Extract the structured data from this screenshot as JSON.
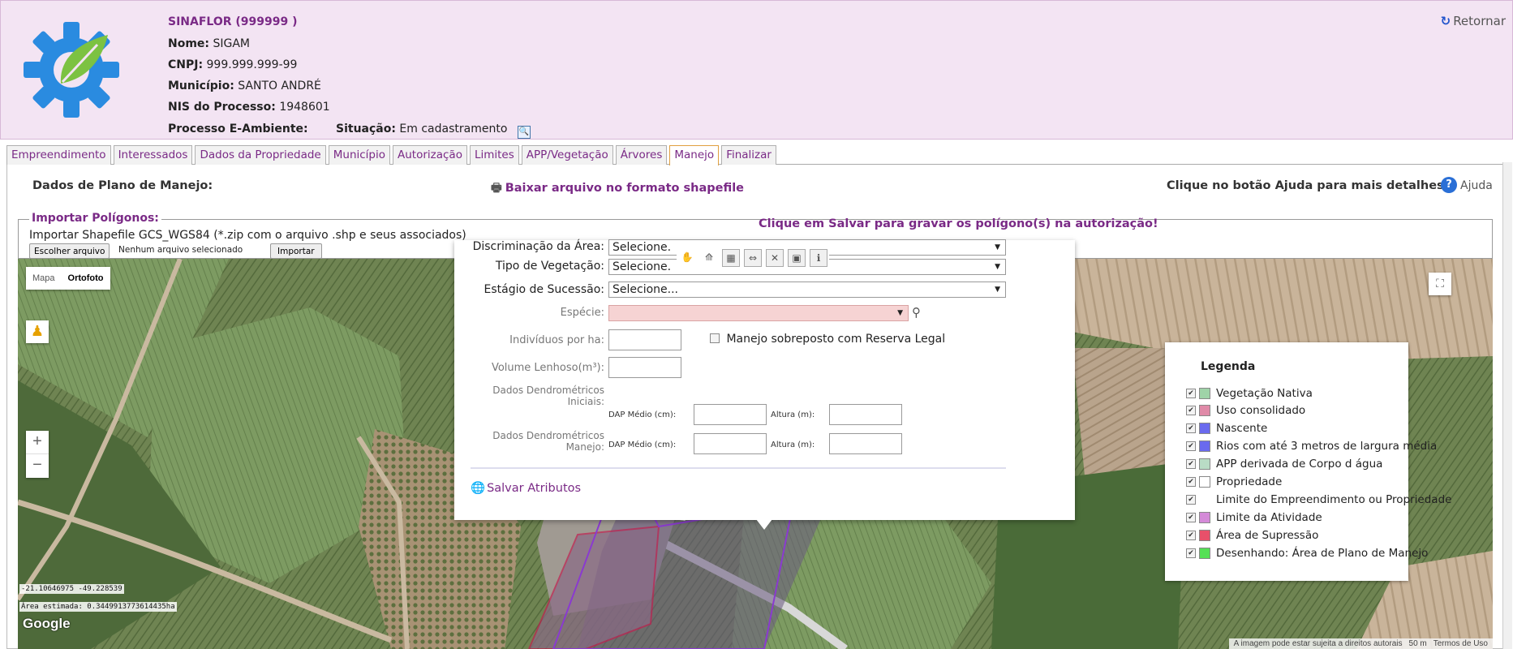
{
  "header": {
    "system": "SINAFLOR (999999 )",
    "nome_label": "Nome:",
    "nome_value": "SIGAM",
    "cnpj_label": "CNPJ:",
    "cnpj_value": "999.999.999-99",
    "municipio_label": "Município:",
    "municipio_value": "SANTO ANDRÉ",
    "nis_label": "NIS do Processo:",
    "nis_value": "1948601",
    "processo_label": "Processo E-Ambiente:",
    "situacao_label": "Situação:",
    "situacao_value": "Em cadastramento",
    "retornar": "Retornar",
    "brand_color": "#7a2a86"
  },
  "tabs": [
    {
      "label": "Empreendimento"
    },
    {
      "label": "Interessados"
    },
    {
      "label": "Dados da Propriedade"
    },
    {
      "label": "Município"
    },
    {
      "label": "Autorização"
    },
    {
      "label": "Limites"
    },
    {
      "label": "APP/Vegetação"
    },
    {
      "label": "Árvores"
    },
    {
      "label": "Manejo",
      "active": true
    },
    {
      "label": "Finalizar"
    }
  ],
  "main": {
    "dados_label": "Dados de Plano de Manejo:",
    "baixar": "Baixar arquivo no formato shapefile",
    "ajuda_hint": "Clique no botão Ajuda para mais detalhes.",
    "ajuda": "Ajuda"
  },
  "import": {
    "legend": "Importar Polígonos:",
    "desc": "Importar Shapefile GCS_WGS84 (*.zip com o arquivo .shp e seus associados)",
    "choose_btn": "Escolher arquivo",
    "no_file": "Nenhum arquivo selecionado",
    "import_btn": "Importar",
    "save_msg": "Clique em Salvar para gravar os polígono(s) na autorização!"
  },
  "map": {
    "type_mapa": "Mapa",
    "type_ortofoto": "Ortofoto",
    "zoom_in": "+",
    "zoom_out": "−",
    "coords": "-21.10646975 -49.228539",
    "area": "Área estimada: 0.3449913773614435ha",
    "google": "Google",
    "attrib": "A imagem pode estar sujeita a direitos autorais",
    "scale": "50 m",
    "terms": "Termos de Uso"
  },
  "popup": {
    "discriminacao_label": "Discriminação da Área:",
    "discriminacao_value": "Selecione.",
    "tipo_label": "Tipo de Vegetação:",
    "tipo_value": "Selecione.",
    "estagio_label": "Estágio de Sucessão:",
    "estagio_value": "Selecione...",
    "especie_label": "Espécie:",
    "individuos_label": "Indivíduos por ha:",
    "manejo_sobreposto": "Manejo sobreposto com Reserva Legal",
    "volume_label": "Volume Lenhoso(m³):",
    "dendro_iniciais_label": "Dados Dendrométricos Iniciais:",
    "dendro_manejo_label": "Dados Dendrométricos Manejo:",
    "dap_label": "DAP Médio (cm):",
    "altura_label": "Altura (m):",
    "salvar": "Salvar Atributos"
  },
  "legend": {
    "title": "Legenda",
    "items": [
      {
        "label": "Vegetação Nativa",
        "color": "#9fd3a8"
      },
      {
        "label": "Uso consolidado",
        "color": "#e08aa8"
      },
      {
        "label": "Nascente",
        "color": "#6a6aee"
      },
      {
        "label": "Rios com até 3 metros de largura média",
        "color": "#6a6aee"
      },
      {
        "label": "APP derivada de Corpo d água",
        "color": "#b9dcc5"
      },
      {
        "label": "Propriedade",
        "color": "#ffffff"
      },
      {
        "label": "Limite do Empreendimento ou Propriedade",
        "color": "none"
      },
      {
        "label": "Limite da Atividade",
        "color": "#d48ad8"
      },
      {
        "label": "Área de Supressão",
        "color": "#e8506a"
      },
      {
        "label": "Desenhando: Área de Plano de Manejo",
        "color": "#55e055"
      }
    ]
  }
}
